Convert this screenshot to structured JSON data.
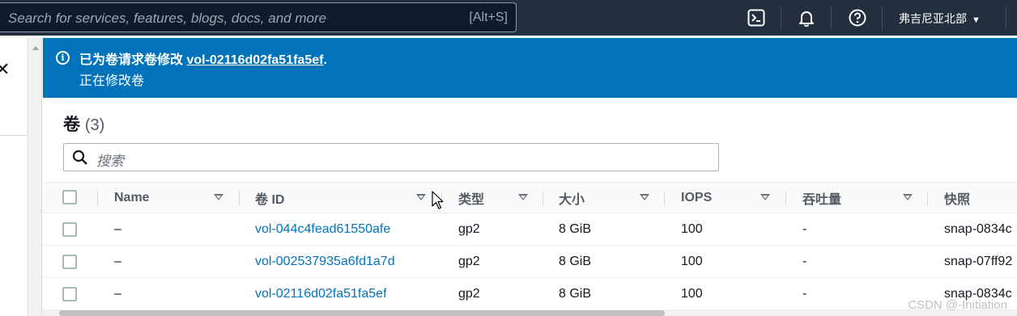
{
  "topnav": {
    "search_placeholder": "Search for services, features, blogs, docs, and more",
    "search_shortcut": "[Alt+S]",
    "region": "弗吉尼亚北部"
  },
  "flash": {
    "title_prefix": "已为卷请求卷修改 ",
    "volume_link": "vol-02116d02fa51fa5ef",
    "title_suffix": ".",
    "subtitle": "正在修改卷"
  },
  "volumes": {
    "heading": "卷",
    "count": "(3)",
    "search_placeholder": "搜索",
    "columns": [
      "Name",
      "卷 ID",
      "类型",
      "大小",
      "IOPS",
      "吞吐量",
      "快照"
    ],
    "rows": [
      {
        "name": "–",
        "volume_id": "vol-044c4fead61550afe",
        "type": "gp2",
        "size": "8 GiB",
        "iops": "100",
        "throughput": "-",
        "snapshot": "snap-0834c"
      },
      {
        "name": "–",
        "volume_id": "vol-002537935a6fd1a7d",
        "type": "gp2",
        "size": "8 GiB",
        "iops": "100",
        "throughput": "-",
        "snapshot": "snap-07ff92"
      },
      {
        "name": "–",
        "volume_id": "vol-02116d02fa51fa5ef",
        "type": "gp2",
        "size": "8 GiB",
        "iops": "100",
        "throughput": "-",
        "snapshot": "snap-0834c"
      }
    ]
  },
  "watermark": "CSDN @-Initiation",
  "icons": {
    "cloudshell": "cloudshell-icon",
    "notifications": "bell-icon",
    "help": "help-icon",
    "info": "info-icon",
    "search": "search-icon",
    "close": "close-icon"
  },
  "colors": {
    "nav_bg": "#232f3e",
    "flash_bg": "#0073bb",
    "link": "#0073bb"
  }
}
